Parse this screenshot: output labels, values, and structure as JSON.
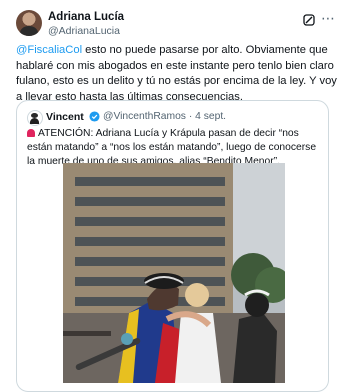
{
  "tweet": {
    "author_name": "Adriana Lucía",
    "author_handle": "@AdrianaLucia",
    "mention": "@FiscaliaCol",
    "body": " esto no puede pasarse por alto. Obviamente que hablaré con mis abogados en este instante pero tenlo bien claro fulano, esto es un delito y tú no estás por encima de la ley. Y voy a llevar esto hasta las últimas consecuencias."
  },
  "quoted": {
    "author_name": "Vincent",
    "author_handle": "@VincenthRamos",
    "separator": " · ",
    "date": "4 sept.",
    "body": "ATENCIÓN: Adriana Lucía y Krápula pasan de decir “nos están matando” a “nos los están matando”, luego de conocerse la muerte de uno de sus amigos, alias “Bendito Menor”."
  },
  "colors": {
    "link": "#1d9bf0",
    "text": "#0f1419",
    "muted": "#536471",
    "border": "#cfd9de"
  },
  "icons": [
    "grok-icon",
    "more-icon",
    "verified-badge-icon",
    "siren-icon"
  ]
}
